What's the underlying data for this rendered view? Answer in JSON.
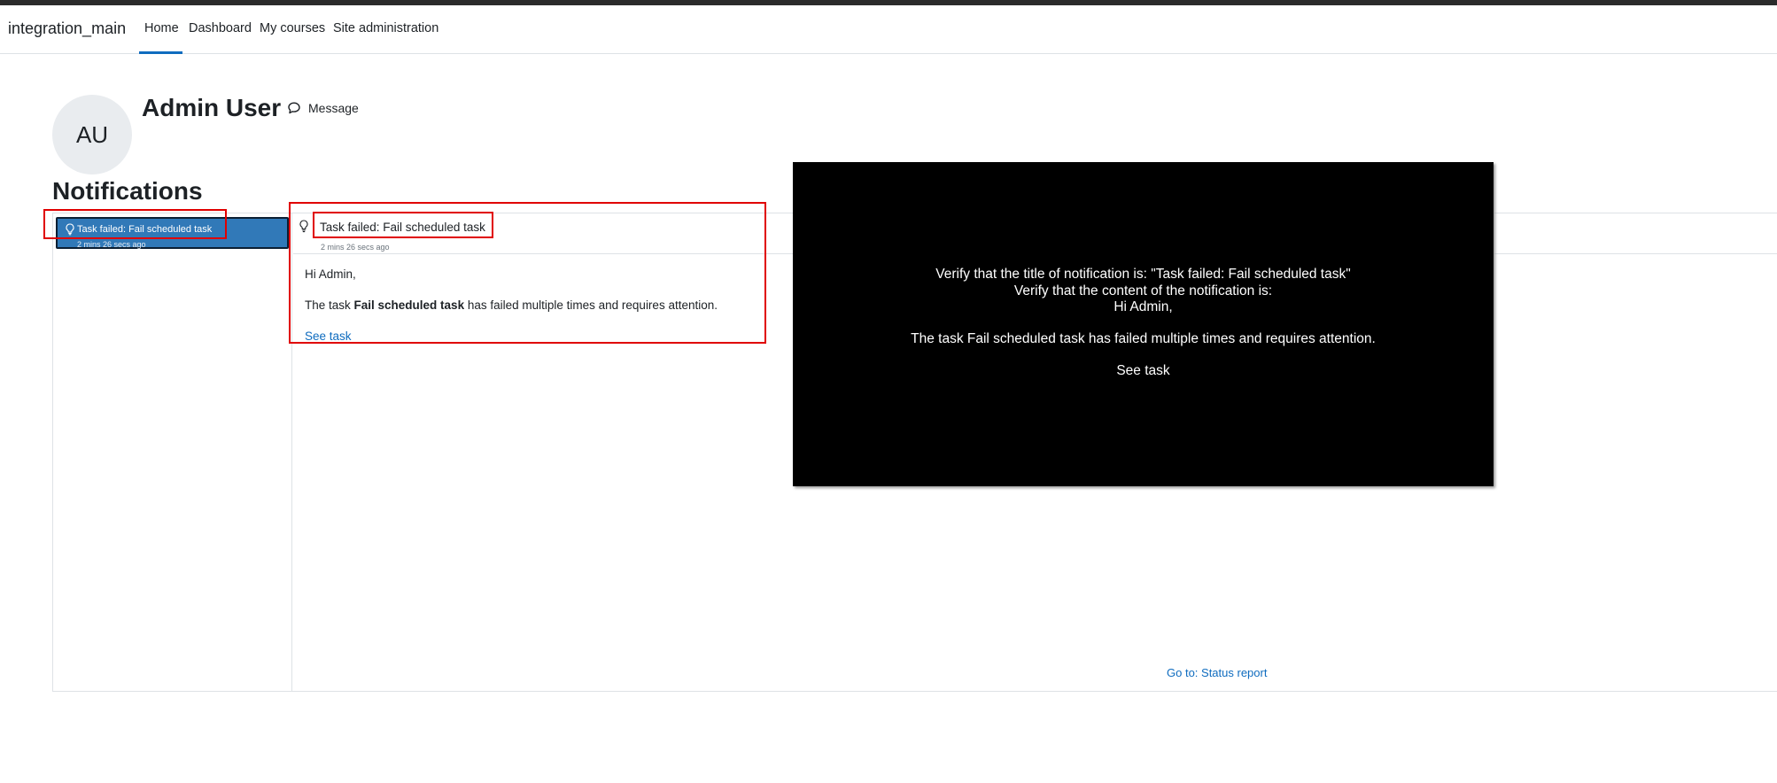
{
  "navbar": {
    "brand": "integration_main",
    "items": [
      {
        "label": "Home",
        "active": true
      },
      {
        "label": "Dashboard"
      },
      {
        "label": "My courses"
      },
      {
        "label": "Site administration"
      }
    ],
    "accent_color": "#0f6cbf"
  },
  "profile": {
    "initials": "AU",
    "name": "Admin User",
    "message_label": "Message",
    "message_icon": "speech-bubble-icon"
  },
  "page": {
    "title": "Notifications"
  },
  "notification_list": {
    "items": [
      {
        "title": "Task failed: Fail scheduled task",
        "time": "2 mins 26 secs ago",
        "icon": "lightbulb-icon",
        "selected": true
      }
    ],
    "selected_color": "#3179b8"
  },
  "notification": {
    "title": "Task failed: Fail scheduled task",
    "time": "2 mins 26 secs ago",
    "greeting": "Hi Admin,",
    "body_prefix": "The task ",
    "body_task": "Fail scheduled task",
    "body_suffix": " has failed multiple times and requires attention.",
    "link_label": "See task",
    "footer_link": "Go to: Status report"
  },
  "overlay": {
    "lines": [
      "Verify that the title of notification is:  \"Task failed: Fail scheduled task\"",
      "Verify that the content of the notification is:",
      "Hi Admin,",
      "The task Fail scheduled task has failed multiple times and requires attention.",
      "See task"
    ]
  },
  "highlight_color": "#e00000"
}
